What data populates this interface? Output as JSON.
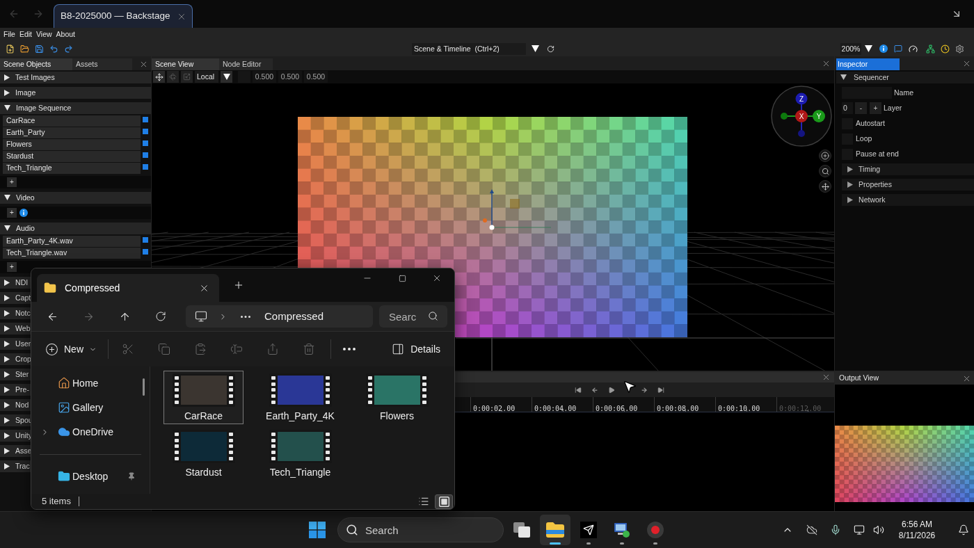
{
  "browser_tab": {
    "title": "B8-2025000 — Backstage"
  },
  "menu": [
    "File",
    "Edit",
    "View",
    "About"
  ],
  "toolbar": {
    "layout": "Scene & Timeline  (Ctrl+2)",
    "zoom": "200%"
  },
  "scene_objects": {
    "tabs": [
      {
        "label": "Scene Objects",
        "selected": true
      },
      {
        "label": "Assets",
        "selected": false
      }
    ],
    "sections": [
      {
        "label": "Test Images",
        "expanded": false
      },
      {
        "label": "Image",
        "expanded": false
      },
      {
        "label": "Image Sequence",
        "expanded": true,
        "items": [
          "CarRace",
          "Earth_Party",
          "Flowers",
          "Stardust",
          "Tech_Triangle"
        ],
        "add": "+",
        "info": false
      },
      {
        "label": "Video",
        "expanded": true,
        "add": "+",
        "info": true
      },
      {
        "label": "Audio",
        "expanded": true,
        "items": [
          "Earth_Party_4K.wav",
          "Tech_Triangle.wav"
        ],
        "add": "+",
        "info": false
      },
      {
        "label": "NDI",
        "expanded": false
      },
      {
        "label": "Capt",
        "expanded": false
      },
      {
        "label": "Notc",
        "expanded": false
      },
      {
        "label": "Web",
        "expanded": false
      },
      {
        "label": "User",
        "expanded": false
      },
      {
        "label": "Crop",
        "expanded": false
      },
      {
        "label": "Ster",
        "expanded": false
      },
      {
        "label": "Pre-",
        "expanded": false
      },
      {
        "label": "Nod",
        "expanded": false
      },
      {
        "label": "Spou",
        "expanded": false
      },
      {
        "label": "Unity",
        "expanded": false
      },
      {
        "label": "Asse",
        "expanded": false
      },
      {
        "label": "Trac",
        "expanded": false
      }
    ]
  },
  "scene_view": {
    "tabs": [
      {
        "label": "Scene View",
        "selected": true
      },
      {
        "label": "Node Editor",
        "selected": false
      }
    ],
    "space": "Local",
    "scale": [
      "0.500",
      "0.500",
      "0.500"
    ],
    "gizmo_axes": [
      "Z",
      "X",
      "Y"
    ]
  },
  "timeline": {
    "ruler": [
      {
        "label": "0:00:02.00",
        "dimmed": false
      },
      {
        "label": "0:00:04.00",
        "dimmed": false
      },
      {
        "label": "0:00:06.00",
        "dimmed": false
      },
      {
        "label": "0:00:08.00",
        "dimmed": false
      },
      {
        "label": "0:00:10.00",
        "dimmed": false
      },
      {
        "label": "0:00:12.00",
        "dimmed": true
      }
    ]
  },
  "inspector": {
    "tab": {
      "label": "Inspector",
      "selected": true
    },
    "section": {
      "label": "Sequencer",
      "expanded": true
    },
    "fields": [
      {
        "kind": "text",
        "label": "Name"
      },
      {
        "kind": "stepper",
        "label": "Layer",
        "value": "0",
        "minus": "-",
        "plus": "+"
      },
      {
        "kind": "checkbox",
        "label": "Autostart",
        "checked": false
      },
      {
        "kind": "checkbox",
        "label": "Loop",
        "checked": false
      },
      {
        "kind": "checkbox",
        "label": "Pause at end",
        "checked": false
      }
    ],
    "groups": [
      {
        "label": "Timing",
        "expanded": false
      },
      {
        "label": "Properties",
        "expanded": false
      },
      {
        "label": "Network",
        "expanded": false
      }
    ]
  },
  "output_view": {
    "title": "Output View"
  },
  "explorer": {
    "tab": "Compressed",
    "address": "Compressed",
    "search": {
      "placeholder": "Searc"
    },
    "new": "New",
    "details": "Details",
    "commands": [
      {
        "kind": "cut",
        "disabled": true
      },
      {
        "kind": "copy",
        "disabled": true
      },
      {
        "kind": "paste",
        "disabled": true
      },
      {
        "kind": "rename",
        "disabled": true
      },
      {
        "kind": "share",
        "disabled": true
      },
      {
        "kind": "delete",
        "disabled": true
      }
    ],
    "nav_groups": [
      [
        {
          "kind": "home",
          "label": "Home",
          "expandable": false,
          "pinned": false
        },
        {
          "kind": "gallery",
          "label": "Gallery",
          "expandable": false,
          "pinned": false
        },
        {
          "kind": "cloud",
          "label": "OneDrive",
          "expandable": true,
          "pinned": false
        }
      ],
      [
        {
          "kind": "desktop",
          "label": "Desktop",
          "expandable": false,
          "pinned": true
        }
      ]
    ],
    "files": [
      {
        "name": "CarRace",
        "selected": true
      },
      {
        "name": "Earth_Party_4K",
        "selected": false
      },
      {
        "name": "Flowers",
        "selected": false
      },
      {
        "name": "Stardust",
        "selected": false
      },
      {
        "name": "Tech_Triangle",
        "selected": false
      }
    ],
    "status": "5 items",
    "views": [
      {
        "kind": "details",
        "selected": false
      },
      {
        "kind": "tiles",
        "selected": true
      }
    ]
  },
  "taskbar": {
    "search": {
      "placeholder": "Search"
    },
    "apps": [
      {
        "kind": "task_view",
        "running": false,
        "active": false
      },
      {
        "kind": "file_explorer",
        "running": true,
        "active": true
      },
      {
        "kind": "send",
        "running": true,
        "active": false
      },
      {
        "kind": "remote_desktop",
        "running": true,
        "active": false
      },
      {
        "kind": "recorder",
        "running": true,
        "active": false
      }
    ],
    "time": "6:56 AM",
    "date": "8/11/2026"
  }
}
